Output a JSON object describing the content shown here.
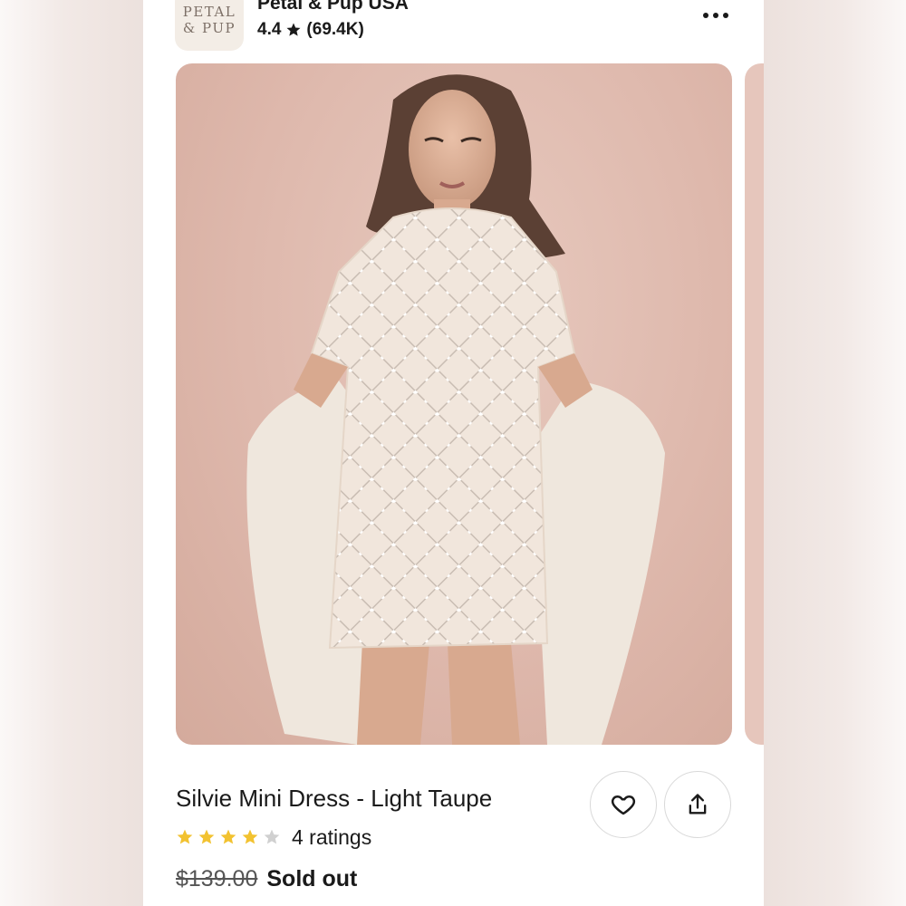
{
  "store": {
    "logo_line1": "PETAL",
    "logo_line2": "& PUP",
    "name": "Petal & Pup USA",
    "rating": "4.4",
    "review_count": "(69.4K)",
    "star_icon": "star-icon",
    "more_icon": "more-horizontal-icon"
  },
  "product": {
    "title": "Silvie Mini Dress - Light Taupe",
    "star_rating": 4,
    "star_max": 5,
    "ratings_label": "4 ratings",
    "original_price": "$139.00",
    "status": "Sold out",
    "favorite_icon": "heart-icon",
    "share_icon": "share-icon"
  },
  "colors": {
    "star_filled": "#f2c230",
    "star_empty": "#d0d0d0",
    "image_background": "#deb8ac",
    "text": "#1a1a1a"
  }
}
